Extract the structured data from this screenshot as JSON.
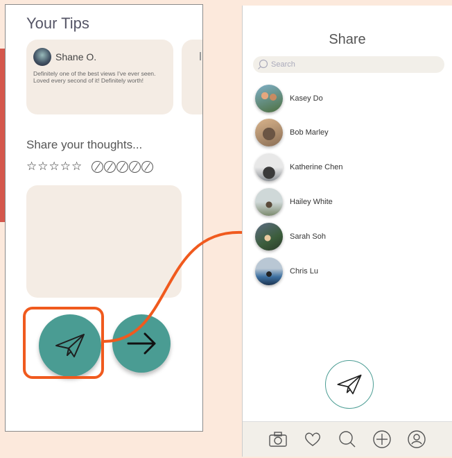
{
  "left_screen": {
    "tips_title": "Your Tips",
    "tip": {
      "author": "Shane O.",
      "text": "Definitely one of the best views I've ever seen. Loved every second of it! Definitely worth!"
    },
    "share_prompt": "Share your thoughts...",
    "stars": [
      "☆",
      "☆",
      "☆",
      "☆",
      "☆"
    ],
    "rating_circles": 5
  },
  "right_screen": {
    "title": "Share",
    "search_placeholder": "Search",
    "contacts": [
      {
        "name": "Kasey Do"
      },
      {
        "name": "Bob Marley"
      },
      {
        "name": "Katherine Chen"
      },
      {
        "name": "Hailey White"
      },
      {
        "name": "Sarah Soh"
      },
      {
        "name": "Chris Lu"
      }
    ],
    "tab_bar": [
      "camera-icon",
      "heart-icon",
      "search-icon",
      "plus-icon",
      "profile-icon"
    ]
  },
  "colors": {
    "background": "#fce9dc",
    "accent": "#4a9c93",
    "highlight": "#f05a1e",
    "card": "#f4ece4"
  }
}
